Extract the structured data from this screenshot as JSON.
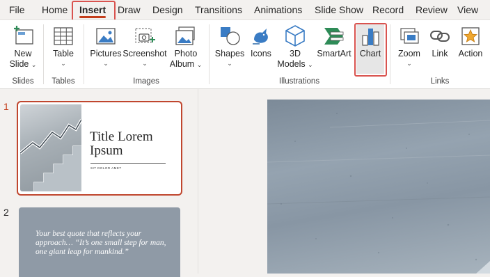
{
  "menu": {
    "tabs": [
      {
        "label": "File"
      },
      {
        "label": "Home"
      },
      {
        "label": "Insert"
      },
      {
        "label": "Draw"
      },
      {
        "label": "Design"
      },
      {
        "label": "Transitions"
      },
      {
        "label": "Animations"
      },
      {
        "label": "Slide Show"
      },
      {
        "label": "Record"
      },
      {
        "label": "Review"
      },
      {
        "label": "View"
      }
    ],
    "active_tab": "Insert"
  },
  "ribbon": {
    "buttons": {
      "new_slide": {
        "label_line1": "New",
        "label_line2": "Slide",
        "chevron": "⌄"
      },
      "table": {
        "label": "Table",
        "chevron": "⌄"
      },
      "pictures": {
        "label": "Pictures",
        "chevron": "⌄"
      },
      "screenshot": {
        "label": "Screenshot",
        "chevron": "⌄"
      },
      "photo_album": {
        "label_line1": "Photo",
        "label_line2": "Album",
        "chevron": "⌄"
      },
      "shapes": {
        "label": "Shapes",
        "chevron": "⌄"
      },
      "icons": {
        "label": "Icons"
      },
      "models3d": {
        "label_line1": "3D",
        "label_line2": "Models",
        "chevron": "⌄"
      },
      "smartart": {
        "label": "SmartArt"
      },
      "chart": {
        "label": "Chart"
      },
      "zoom": {
        "label": "Zoom",
        "chevron": "⌄"
      },
      "link": {
        "label": "Link"
      },
      "action": {
        "label": "Action"
      }
    },
    "groups": {
      "slides": "Slides",
      "tables": "Tables",
      "images": "Images",
      "illustrations": "Illustrations",
      "links": "Links"
    }
  },
  "thumbnails": [
    {
      "number": "1",
      "title_line1": "Title Lorem",
      "title_line2": "Ipsum",
      "subtitle": "SIT DOLOR AMET"
    },
    {
      "number": "2",
      "quote": "Your best quote that reflects your approach… “It’s one small step for man, one giant leap for mankind.”"
    }
  ],
  "colors": {
    "accent": "#c43e1c",
    "highlight": "#d9534f",
    "ribbon_bg": "#ffffff",
    "window_bg": "#f3f1ef"
  }
}
